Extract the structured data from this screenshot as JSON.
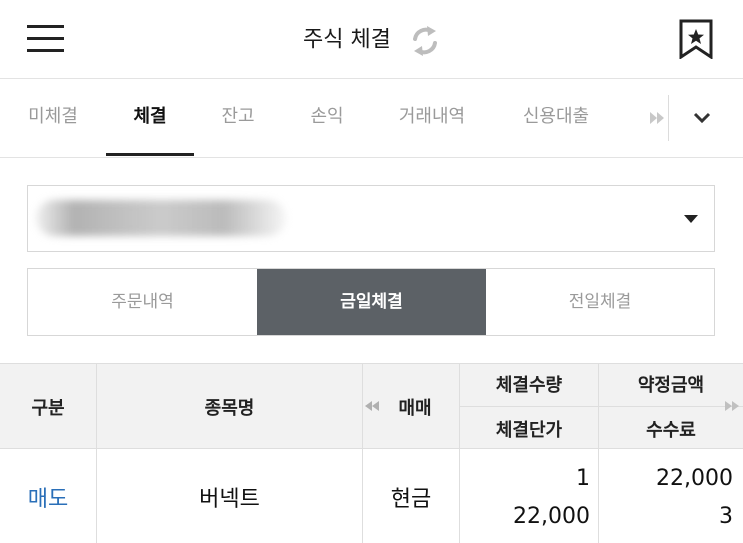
{
  "header": {
    "title": "주식 체결",
    "menu_icon": "hamburger-menu-icon",
    "refresh_icon": "refresh-icon",
    "bookmark_icon": "bookmark-star-icon"
  },
  "tabs": {
    "items": [
      {
        "label": "미체결",
        "active": false
      },
      {
        "label": "체결",
        "active": true
      },
      {
        "label": "잔고",
        "active": false
      },
      {
        "label": "손익",
        "active": false
      },
      {
        "label": "거래내역",
        "active": false
      },
      {
        "label": "신용대출",
        "active": false
      }
    ],
    "more_icon": "double-arrow-right-icon",
    "dropdown_icon": "chevron-down-icon"
  },
  "account_select": {
    "value_obscured": true,
    "caret_icon": "caret-down-icon"
  },
  "segment": {
    "items": [
      {
        "label": "주문내역",
        "active": false
      },
      {
        "label": "금일체결",
        "active": true
      },
      {
        "label": "전일체결",
        "active": false
      }
    ]
  },
  "table": {
    "headers": {
      "type": "구분",
      "name": "종목명",
      "side": "매매",
      "qty": "체결수량",
      "price": "체결단가",
      "amount": "약정금액",
      "fee": "수수료"
    },
    "rows": [
      {
        "type": "매도",
        "name": "버넥트",
        "side": "현금",
        "qty": "1",
        "price": "22,000",
        "amount": "22,000",
        "fee": "3"
      }
    ]
  },
  "colors": {
    "active_segment_bg": "#5c6166",
    "sell_text": "#2a6fb8",
    "inactive_text": "#9a9a9a",
    "header_bg": "#f2f2f2"
  }
}
